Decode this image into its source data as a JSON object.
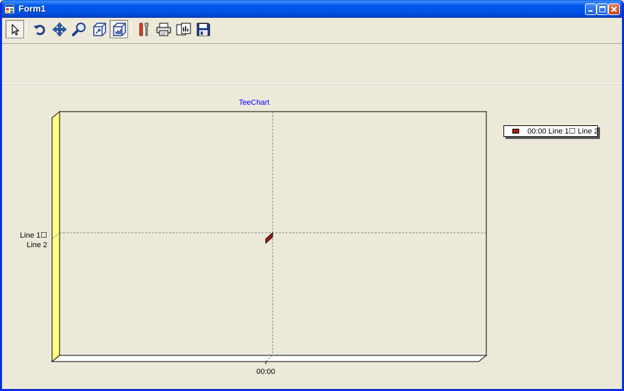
{
  "window": {
    "title": "Form1"
  },
  "toolbar": {
    "buttons": [
      {
        "name": "pointer-tool",
        "icon": "cursor-arrow-icon"
      },
      {
        "name": "rotate-tool",
        "icon": "rotate-icon"
      },
      {
        "name": "move-tool",
        "icon": "move-arrows-icon"
      },
      {
        "name": "zoom-tool",
        "icon": "magnifier-icon"
      },
      {
        "name": "depth-tool",
        "icon": "depth-icon"
      },
      {
        "name": "view3d-tool",
        "icon": "3d-view-icon"
      },
      {
        "name": "editor-tool",
        "icon": "tools-icon"
      },
      {
        "name": "print-tool",
        "icon": "printer-icon"
      },
      {
        "name": "export-tool",
        "icon": "export-icon"
      },
      {
        "name": "save-tool",
        "icon": "floppy-disk-icon"
      }
    ]
  },
  "chart_data": {
    "type": "bar",
    "title": "TeeChart",
    "categories": [
      "00:00"
    ],
    "y_categories": [
      "Line 1☐ Line 2"
    ],
    "series": [
      {
        "values": [
          1
        ]
      }
    ],
    "legend": {
      "placement": "right",
      "entries": [
        "00:00 Line 1☐ Line 2"
      ]
    },
    "grid": true,
    "three_d": true,
    "colors": {
      "series": "#b01515",
      "left_wall": "#ffff80",
      "title": "#0000ff"
    }
  },
  "labels": {
    "y_line1": "Line 1☐",
    "y_line2": "Line 2",
    "x_tick": "00:00",
    "legend_entry": "00:00 Line 1☐ Line 2"
  }
}
